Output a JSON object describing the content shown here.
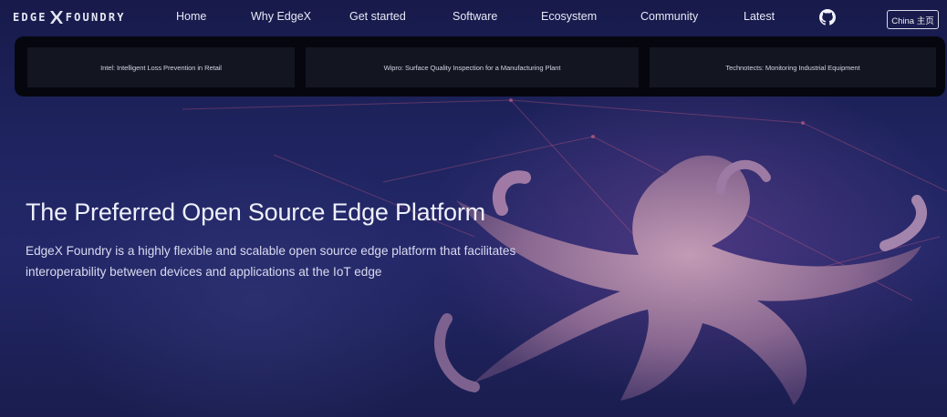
{
  "brand": {
    "logo_text_left": "EDGE",
    "logo_text_right": "FOUNDRY"
  },
  "nav": {
    "items": [
      "Home",
      "Why EdgeX",
      "Get started",
      "Software",
      "Ecosystem",
      "Community",
      "Latest"
    ],
    "github_icon": "github-icon",
    "china_label": "China 主页"
  },
  "cases": [
    "Intel: Intelligent Loss Prevention in Retail",
    "Wipro: Surface Quality Inspection for a Manufacturing Plant",
    "Technotects: Monitoring Industrial Equipment"
  ],
  "hero": {
    "title": "The Preferred Open Source Edge Platform",
    "subtitle": "EdgeX Foundry is a highly flexible and scalable open source edge platform that facilitates interoperability between devices and applications at the IoT edge"
  },
  "colors": {
    "accent": "#ff5a7a",
    "background": "#1f2460"
  }
}
